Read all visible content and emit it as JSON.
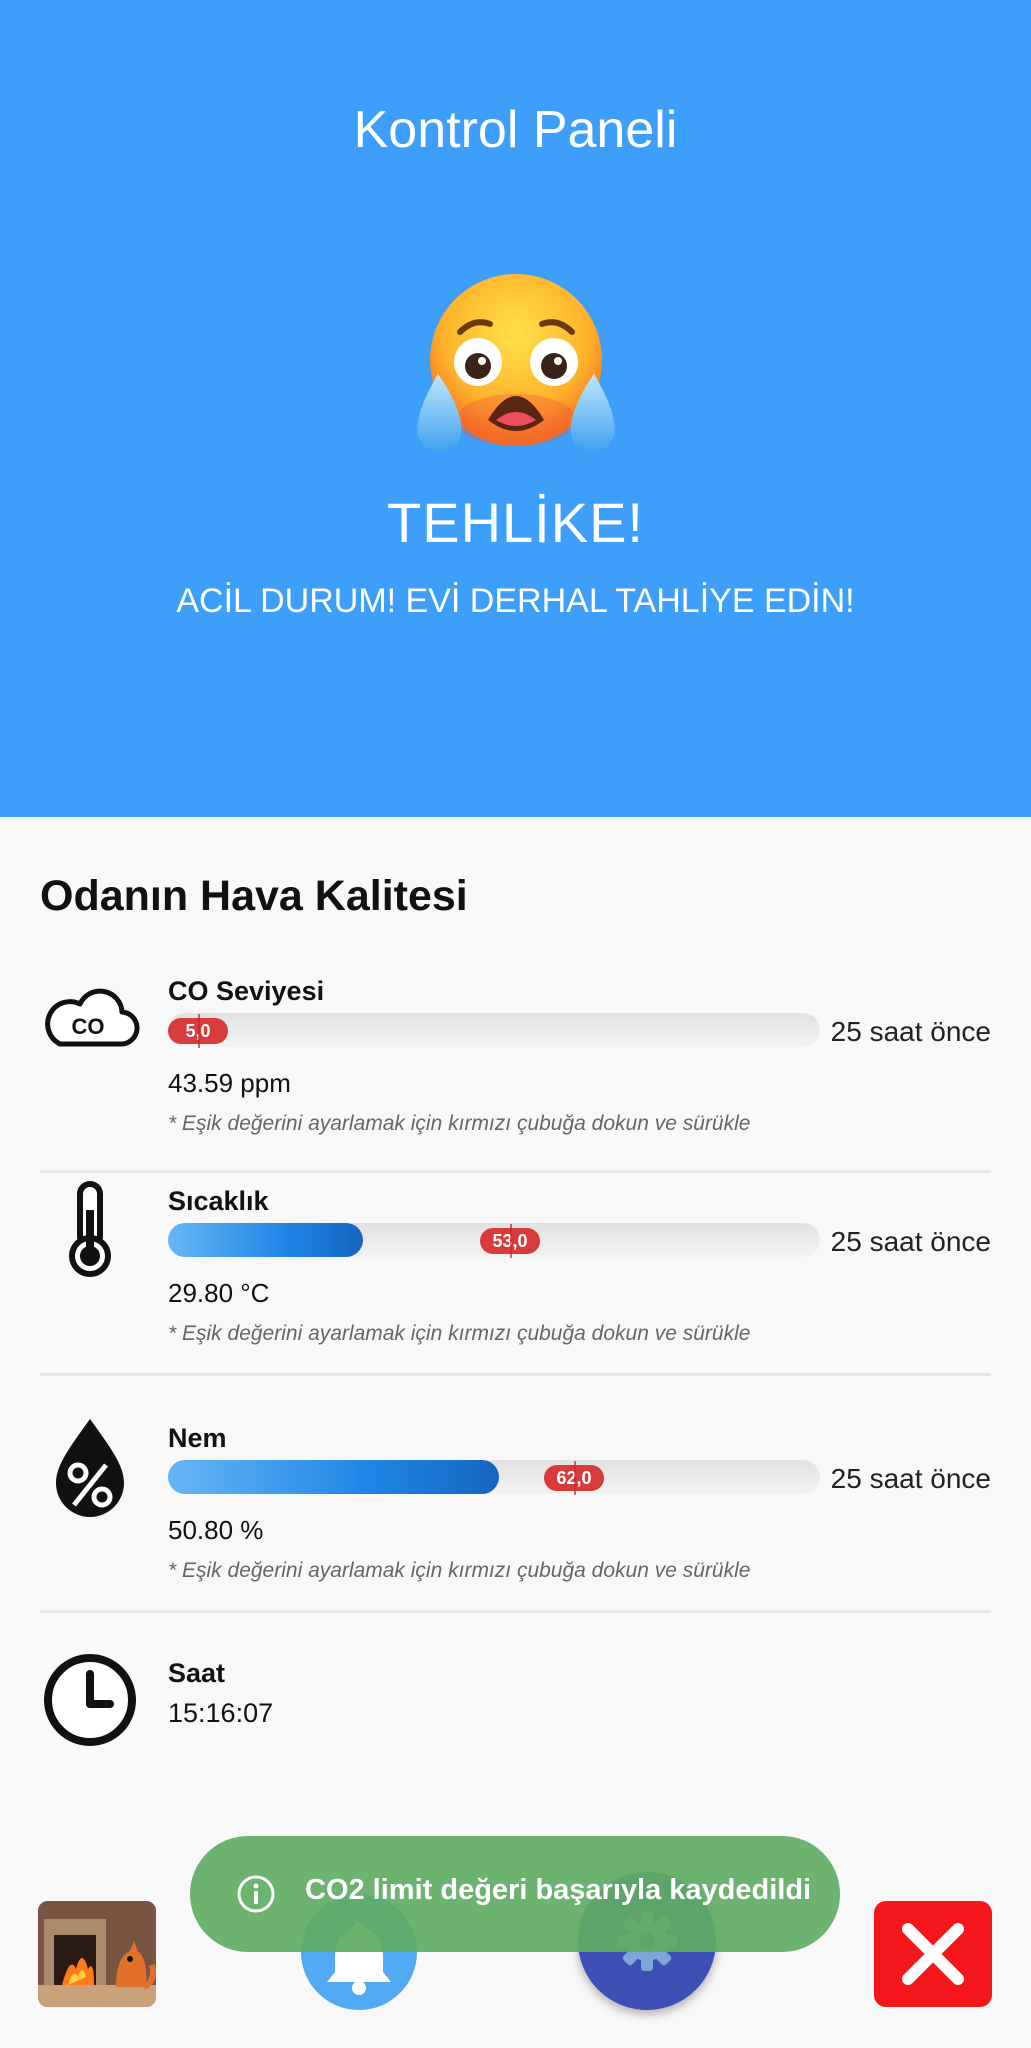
{
  "hero": {
    "title": "Kontrol Paneli",
    "status": "TEHLİKE!",
    "message": "ACİL DURUM! EVİ DERHAL TAHLİYE EDİN!",
    "color": "#3d9ffa"
  },
  "section_title": "Odanın Hava Kalitesi",
  "sensors": [
    {
      "name": "CO Seviyesi",
      "icon": "co-cloud-icon",
      "value": "43.59 ppm",
      "threshold": "5,0",
      "fill_fraction": 0.0,
      "time": "25 saat önce",
      "hint": "* Eşik değerini ayarlamak için kırmızı çubuğa dokun ve sürükle"
    },
    {
      "name": "Sıcaklık",
      "icon": "thermometer-icon",
      "value": "29.80 °C",
      "threshold": "53,0",
      "fill_fraction": 0.3,
      "time": "25 saat önce",
      "hint": "* Eşik değerini ayarlamak için kırmızı çubuğa dokun ve sürükle"
    },
    {
      "name": "Nem",
      "icon": "humidity-drop-icon",
      "value": "50.80 %",
      "threshold": "62,0",
      "fill_fraction": 0.508,
      "time": "25 saat önce",
      "hint": "* Eşik değerini ayarlamak için kırmızı çubuğa dokun ve sürükle"
    }
  ],
  "clock": {
    "title": "Saat",
    "value": "15:16:07",
    "icon": "clock-icon"
  },
  "snackbar": {
    "text": "CO2 limit değeri başarıyla kaydedildi",
    "icon": "info-icon"
  },
  "bottom": {
    "thumbnail": "fireplace-fox-image",
    "bell_icon": "bell-icon",
    "gear_icon": "gear-icon",
    "close_icon": "close-icon",
    "close_color": "#f5161b"
  }
}
